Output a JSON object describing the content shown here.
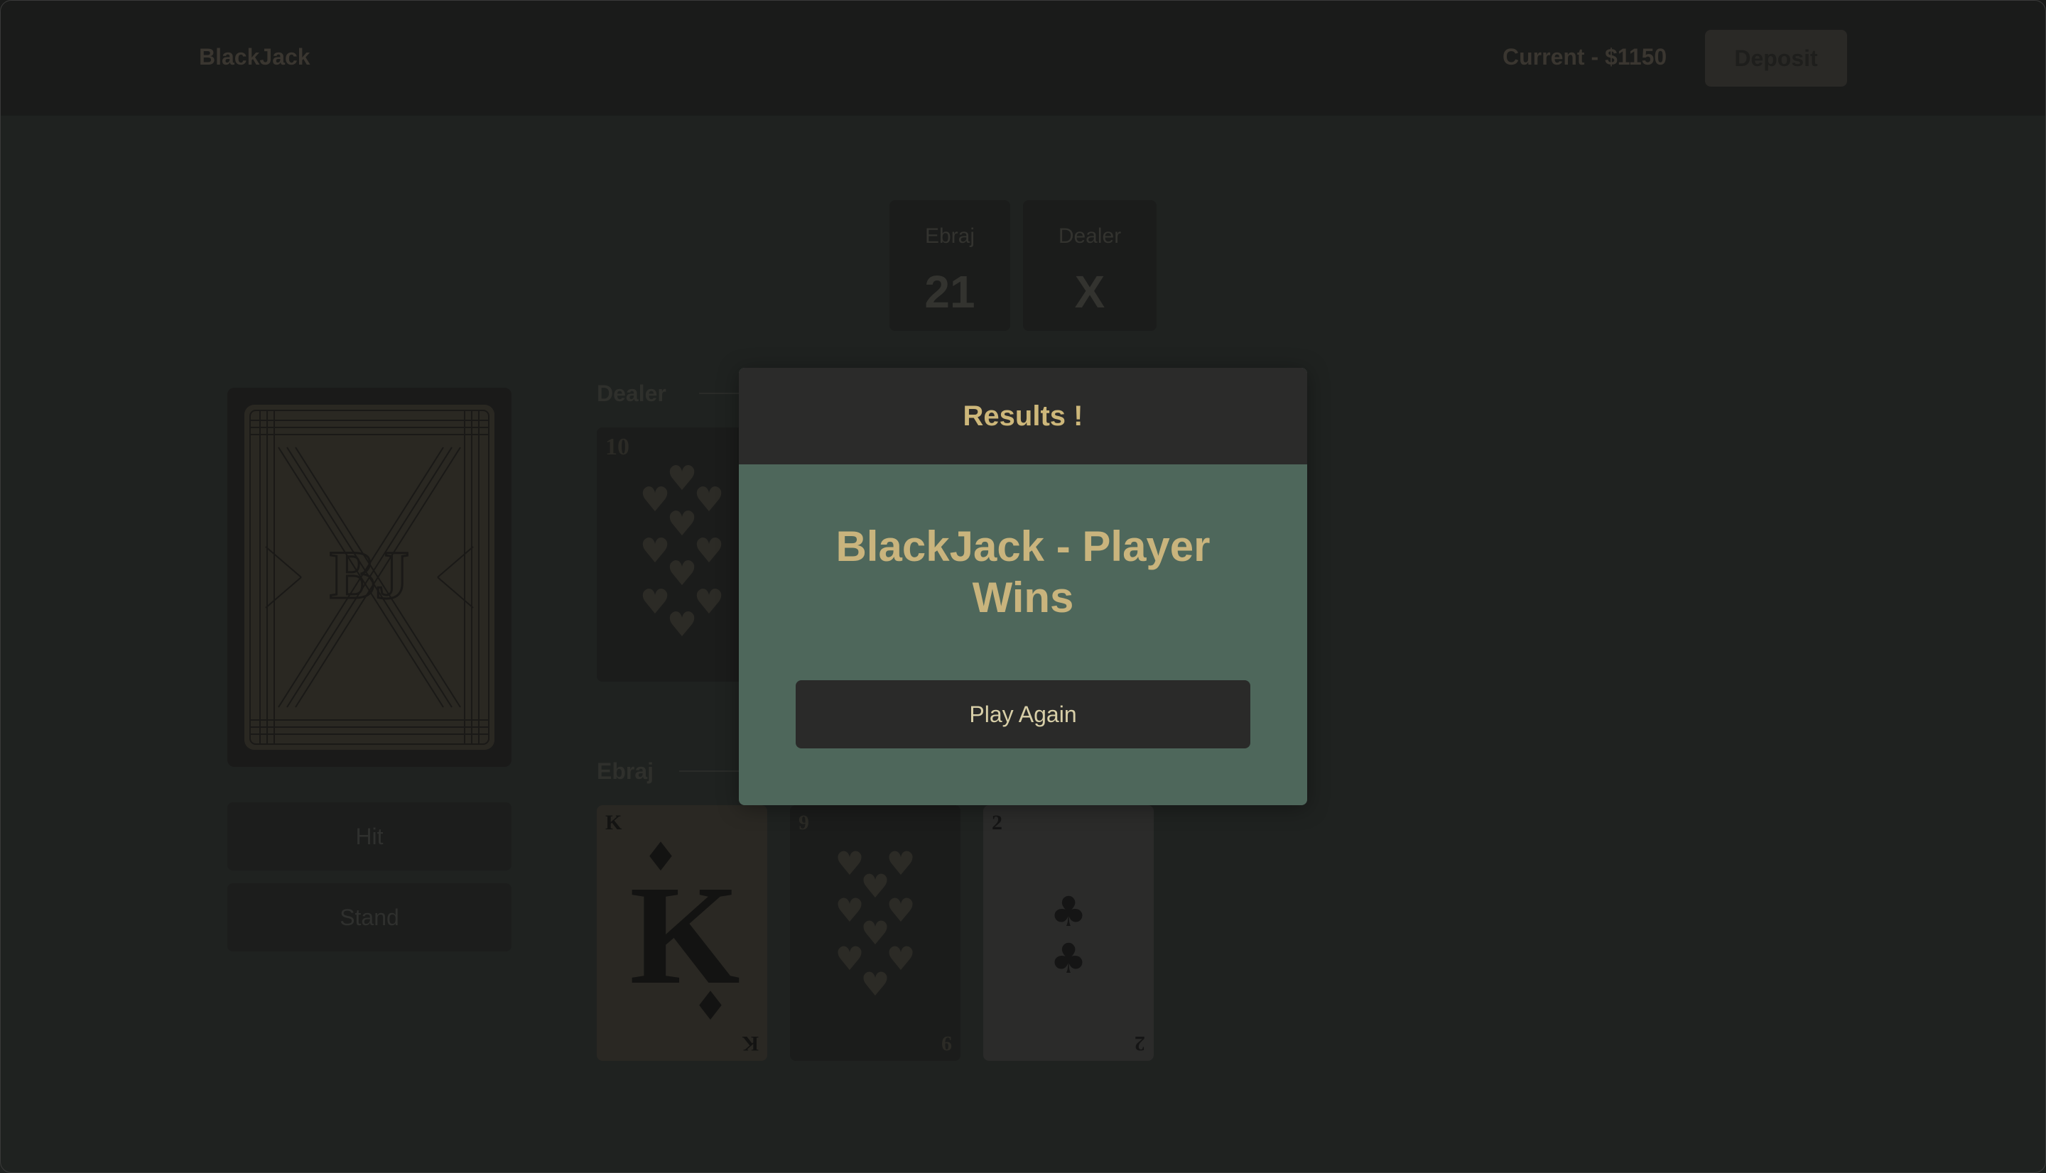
{
  "navbar": {
    "brand": "BlackJack",
    "balance": "Current - $1150",
    "deposit_label": "Deposit"
  },
  "scores": {
    "player": {
      "name": "Ebraj",
      "value": "21"
    },
    "dealer": {
      "name": "Dealer",
      "value": "X"
    }
  },
  "deck": {
    "back_monogram": "BJ"
  },
  "actions": {
    "hit_label": "Hit",
    "stand_label": "Stand"
  },
  "hands": {
    "dealer": {
      "label": "Dealer",
      "cards": [
        {
          "rank": "10",
          "suit": "hearts",
          "color": "#1b1c1b",
          "ink": "#2c2b26"
        }
      ]
    },
    "player": {
      "label": "Ebraj",
      "cards": [
        {
          "rank": "K",
          "suit": "diamonds",
          "color": "#2a2823",
          "ink": "#131312"
        },
        {
          "rank": "9",
          "suit": "hearts",
          "color": "#1b1c1b",
          "ink": "#2c2b26"
        },
        {
          "rank": "2",
          "suit": "clubs",
          "color": "#2b2b2a",
          "ink": "#151515"
        }
      ]
    }
  },
  "modal": {
    "title": "Results !",
    "message": "BlackJack - Player Wins",
    "play_again_label": "Play Again"
  },
  "colors": {
    "accent": "#cdb77a",
    "modal_body": "#4e675b",
    "modal_header": "#2b2b2a",
    "page_bg": "#1f2220"
  }
}
